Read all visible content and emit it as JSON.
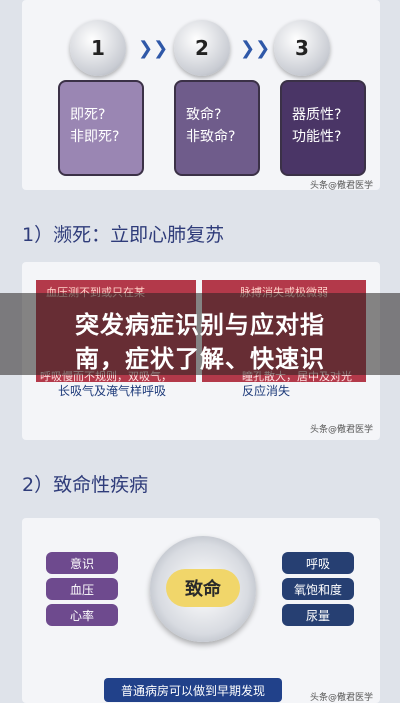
{
  "steps": [
    "1",
    "2",
    "3"
  ],
  "boxes": [
    {
      "line1": "即死?",
      "line2": "非即死?"
    },
    {
      "line1": "致命?",
      "line2": "非致命?"
    },
    {
      "line1": "器质性?",
      "line2": "功能性?"
    }
  ],
  "watermark": "头条@儆君医学",
  "section1": "1）濒死：立即心肺复苏",
  "mid": {
    "left_red_top": "血压测不到或只在某",
    "right_red_top": "脉搏消失或极微弱",
    "left_bottom": "长吸气及淹气样呼吸",
    "right_bottom": "反应消失",
    "left_row2": "呼吸慢而不规则，双吸气，",
    "right_row2": "瞳孔散大，居中及对光"
  },
  "overlay_title_1": "突发病症识别与应对指",
  "overlay_title_2": "南，症状了解、快速识",
  "section2": "2）致命性疾病",
  "left_items": [
    "意识",
    "血压",
    "心率"
  ],
  "right_items": [
    "呼吸",
    "氧饱和度",
    "尿量"
  ],
  "center_label": "致命",
  "banner": "普通病房可以做到早期发现"
}
